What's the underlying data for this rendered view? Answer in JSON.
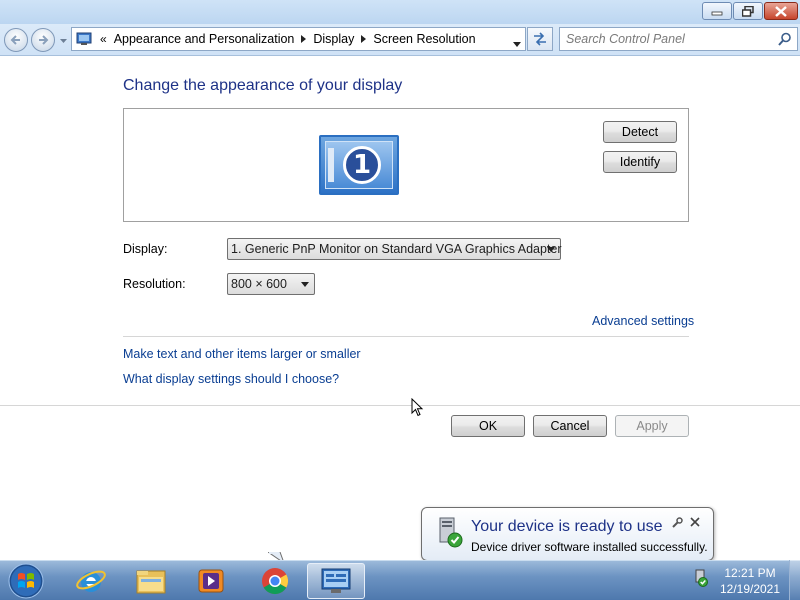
{
  "breadcrumb": {
    "overflow": "«",
    "items": [
      "Appearance and Personalization",
      "Display",
      "Screen Resolution"
    ]
  },
  "search": {
    "placeholder": "Search Control Panel"
  },
  "content": {
    "heading": "Change the appearance of your display",
    "monitor_number": "1",
    "detect_label": "Detect",
    "identify_label": "Identify",
    "display_label": "Display:",
    "display_value": "1. Generic PnP Monitor on Standard VGA Graphics Adapter",
    "resolution_label": "Resolution:",
    "resolution_value": "800 × 600",
    "advanced_link": "Advanced settings",
    "link_text_size": "Make text and other items larger or smaller",
    "link_help": "What display settings should I choose?"
  },
  "buttons": {
    "ok": "OK",
    "cancel": "Cancel",
    "apply": "Apply"
  },
  "notification": {
    "title": "Your device is ready to use",
    "text": "Device driver software installed successfully."
  },
  "taskbar": {
    "time": "12:21 PM",
    "date": "12/19/2021",
    "items": [
      "internet-explorer-icon",
      "file-explorer-icon",
      "media-player-icon",
      "chrome-icon",
      "control-panel-icon"
    ]
  },
  "colors": {
    "heading": "#1e3287",
    "link": "#0a3e92",
    "taskbar": "#4e78ad"
  }
}
